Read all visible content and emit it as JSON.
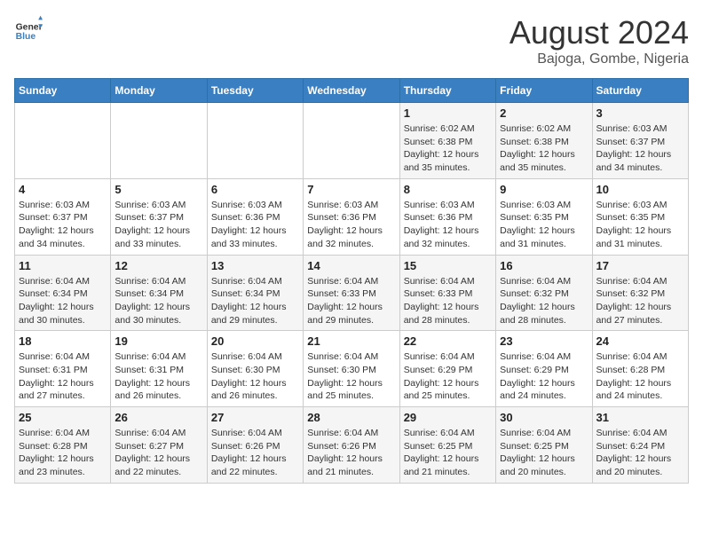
{
  "logo": {
    "line1": "General",
    "line2": "Blue"
  },
  "title": "August 2024",
  "subtitle": "Bajoga, Gombe, Nigeria",
  "days_of_week": [
    "Sunday",
    "Monday",
    "Tuesday",
    "Wednesday",
    "Thursday",
    "Friday",
    "Saturday"
  ],
  "weeks": [
    [
      {
        "day": "",
        "info": ""
      },
      {
        "day": "",
        "info": ""
      },
      {
        "day": "",
        "info": ""
      },
      {
        "day": "",
        "info": ""
      },
      {
        "day": "1",
        "info": "Sunrise: 6:02 AM\nSunset: 6:38 PM\nDaylight: 12 hours and 35 minutes."
      },
      {
        "day": "2",
        "info": "Sunrise: 6:02 AM\nSunset: 6:38 PM\nDaylight: 12 hours and 35 minutes."
      },
      {
        "day": "3",
        "info": "Sunrise: 6:03 AM\nSunset: 6:37 PM\nDaylight: 12 hours and 34 minutes."
      }
    ],
    [
      {
        "day": "4",
        "info": "Sunrise: 6:03 AM\nSunset: 6:37 PM\nDaylight: 12 hours and 34 minutes."
      },
      {
        "day": "5",
        "info": "Sunrise: 6:03 AM\nSunset: 6:37 PM\nDaylight: 12 hours and 33 minutes."
      },
      {
        "day": "6",
        "info": "Sunrise: 6:03 AM\nSunset: 6:36 PM\nDaylight: 12 hours and 33 minutes."
      },
      {
        "day": "7",
        "info": "Sunrise: 6:03 AM\nSunset: 6:36 PM\nDaylight: 12 hours and 32 minutes."
      },
      {
        "day": "8",
        "info": "Sunrise: 6:03 AM\nSunset: 6:36 PM\nDaylight: 12 hours and 32 minutes."
      },
      {
        "day": "9",
        "info": "Sunrise: 6:03 AM\nSunset: 6:35 PM\nDaylight: 12 hours and 31 minutes."
      },
      {
        "day": "10",
        "info": "Sunrise: 6:03 AM\nSunset: 6:35 PM\nDaylight: 12 hours and 31 minutes."
      }
    ],
    [
      {
        "day": "11",
        "info": "Sunrise: 6:04 AM\nSunset: 6:34 PM\nDaylight: 12 hours and 30 minutes."
      },
      {
        "day": "12",
        "info": "Sunrise: 6:04 AM\nSunset: 6:34 PM\nDaylight: 12 hours and 30 minutes."
      },
      {
        "day": "13",
        "info": "Sunrise: 6:04 AM\nSunset: 6:34 PM\nDaylight: 12 hours and 29 minutes."
      },
      {
        "day": "14",
        "info": "Sunrise: 6:04 AM\nSunset: 6:33 PM\nDaylight: 12 hours and 29 minutes."
      },
      {
        "day": "15",
        "info": "Sunrise: 6:04 AM\nSunset: 6:33 PM\nDaylight: 12 hours and 28 minutes."
      },
      {
        "day": "16",
        "info": "Sunrise: 6:04 AM\nSunset: 6:32 PM\nDaylight: 12 hours and 28 minutes."
      },
      {
        "day": "17",
        "info": "Sunrise: 6:04 AM\nSunset: 6:32 PM\nDaylight: 12 hours and 27 minutes."
      }
    ],
    [
      {
        "day": "18",
        "info": "Sunrise: 6:04 AM\nSunset: 6:31 PM\nDaylight: 12 hours and 27 minutes."
      },
      {
        "day": "19",
        "info": "Sunrise: 6:04 AM\nSunset: 6:31 PM\nDaylight: 12 hours and 26 minutes."
      },
      {
        "day": "20",
        "info": "Sunrise: 6:04 AM\nSunset: 6:30 PM\nDaylight: 12 hours and 26 minutes."
      },
      {
        "day": "21",
        "info": "Sunrise: 6:04 AM\nSunset: 6:30 PM\nDaylight: 12 hours and 25 minutes."
      },
      {
        "day": "22",
        "info": "Sunrise: 6:04 AM\nSunset: 6:29 PM\nDaylight: 12 hours and 25 minutes."
      },
      {
        "day": "23",
        "info": "Sunrise: 6:04 AM\nSunset: 6:29 PM\nDaylight: 12 hours and 24 minutes."
      },
      {
        "day": "24",
        "info": "Sunrise: 6:04 AM\nSunset: 6:28 PM\nDaylight: 12 hours and 24 minutes."
      }
    ],
    [
      {
        "day": "25",
        "info": "Sunrise: 6:04 AM\nSunset: 6:28 PM\nDaylight: 12 hours and 23 minutes."
      },
      {
        "day": "26",
        "info": "Sunrise: 6:04 AM\nSunset: 6:27 PM\nDaylight: 12 hours and 22 minutes."
      },
      {
        "day": "27",
        "info": "Sunrise: 6:04 AM\nSunset: 6:26 PM\nDaylight: 12 hours and 22 minutes."
      },
      {
        "day": "28",
        "info": "Sunrise: 6:04 AM\nSunset: 6:26 PM\nDaylight: 12 hours and 21 minutes."
      },
      {
        "day": "29",
        "info": "Sunrise: 6:04 AM\nSunset: 6:25 PM\nDaylight: 12 hours and 21 minutes."
      },
      {
        "day": "30",
        "info": "Sunrise: 6:04 AM\nSunset: 6:25 PM\nDaylight: 12 hours and 20 minutes."
      },
      {
        "day": "31",
        "info": "Sunrise: 6:04 AM\nSunset: 6:24 PM\nDaylight: 12 hours and 20 minutes."
      }
    ]
  ]
}
